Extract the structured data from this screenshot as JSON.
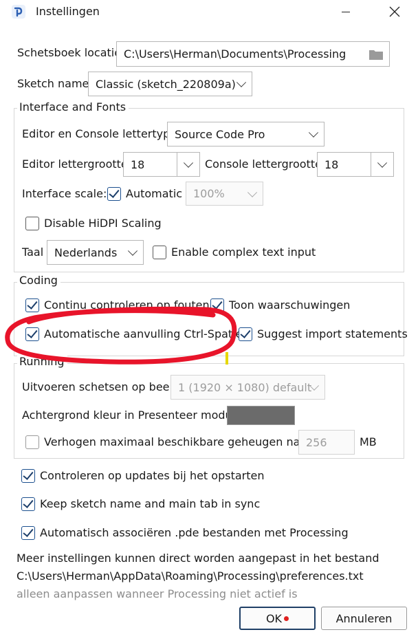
{
  "window": {
    "title": "Instellingen"
  },
  "general": {
    "sketchbook_label": "Schetsboek locatie",
    "sketchbook_path": "C:\\Users\\Herman\\Documents\\Processing",
    "sketch_name_label": "Sketch name",
    "sketch_name_value": "Classic (sketch_220809a)"
  },
  "interface": {
    "title": "Interface and Fonts",
    "editor_font_label": "Editor en Console lettertype",
    "editor_font_value": "Source Code Pro",
    "editor_size_label": "Editor lettergrootte",
    "editor_size_value": "18",
    "console_size_label": "Console lettergrootte",
    "console_size_value": "18",
    "scale_label": "Interface scale:",
    "automatic_label": "Automatic",
    "automatic_checked": true,
    "scale_value": "100%",
    "hidpi_label": "Disable HiDPI Scaling",
    "hidpi_checked": false,
    "language_label": "Taal",
    "language_value": "Nederlands",
    "complex_text_label": "Enable complex text input",
    "complex_text_checked": false
  },
  "coding": {
    "title": "Coding",
    "continuous_label": "Continu controleren op fouten",
    "continuous_checked": true,
    "warnings_label": "Toon waarschuwingen",
    "warnings_checked": true,
    "autocomplete_label": "Automatische aanvulling Ctrl-Spatie",
    "autocomplete_checked": true,
    "imports_label": "Suggest import statements",
    "imports_checked": true
  },
  "running": {
    "title": "Running",
    "display_label": "Uitvoeren schetsen op beeld",
    "display_value": "1 (1920 × 1080) default",
    "present_color_label": "Achtergrond kleur in Presenteer modus",
    "present_color": "#6b6b6b",
    "memory_label": "Verhogen maximaal beschikbare geheugen naar",
    "memory_checked": false,
    "memory_value": "256",
    "memory_unit": "MB"
  },
  "options": {
    "updates_label": "Controleren op updates bij het opstarten",
    "updates_checked": true,
    "sync_label": "Keep sketch name and main tab in sync",
    "sync_checked": true,
    "associate_label": "Automatisch associëren .pde bestanden met Processing",
    "associate_checked": true
  },
  "footer": {
    "more_settings": "Meer instellingen kunnen direct worden aangepast in het bestand",
    "prefs_path": "C:\\Users\\Herman\\AppData\\Roaming\\Processing\\preferences.txt",
    "note": "alleen aanpassen wanneer Processing niet actief is"
  },
  "buttons": {
    "ok": "OK",
    "cancel": "Annuleren"
  },
  "colors": {
    "accent": "#1d3f6b",
    "annotation": "#e8142a",
    "text_cursor": "#e6d800"
  }
}
